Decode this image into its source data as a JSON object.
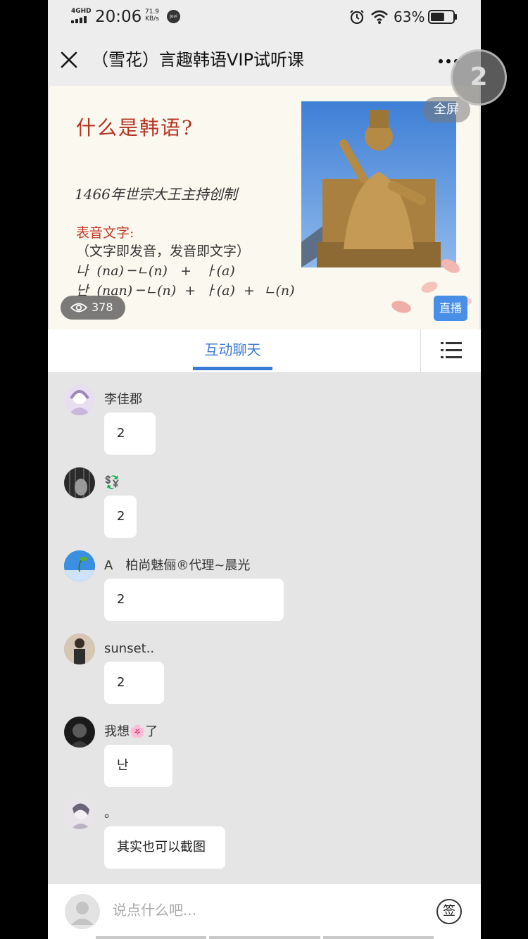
{
  "status_bar": {
    "network": "4GHD",
    "time": "20:06",
    "speed_value": "71.9",
    "speed_unit": "KB/s",
    "vivo_badge": "Jovi",
    "battery_percent": "63%",
    "battery_level": 0.63
  },
  "header": {
    "title": "（雪花）言趣韩语VIP试听课",
    "close_icon": "close-icon",
    "more_icon": "more-icon"
  },
  "floating_badge": "2",
  "video": {
    "slide": {
      "title": "什么是韩语?",
      "line1": "1466年世宗大王主持创制",
      "line2": "表音文字:",
      "line3": "（文字即发音，发音即文字）",
      "line4": "나  (na) ─ㄴ(n)   +   ㅏ(a)",
      "line5": "난  (nan) ─ㄴ(n)  +  ㅏ(a)  +  ㄴ(n)"
    },
    "fullscreen_label": "全屏",
    "view_count": "378",
    "live_label": "直播"
  },
  "tabs": {
    "active": "互动聊天",
    "menu_icon": "list-menu-icon"
  },
  "messages": [
    {
      "name": "李佳郡",
      "text": "2"
    },
    {
      "name": "💱",
      "text": "2"
    },
    {
      "name": "A　柏尚魅俪®代理~晨光",
      "text": "2"
    },
    {
      "name": "sunset..",
      "text": "2"
    },
    {
      "name": "我想🌸了",
      "text": "난"
    },
    {
      "name": "。",
      "text": "其实也可以截图"
    }
  ],
  "input": {
    "placeholder": "说点什么吧...",
    "sign_label": "签"
  }
}
